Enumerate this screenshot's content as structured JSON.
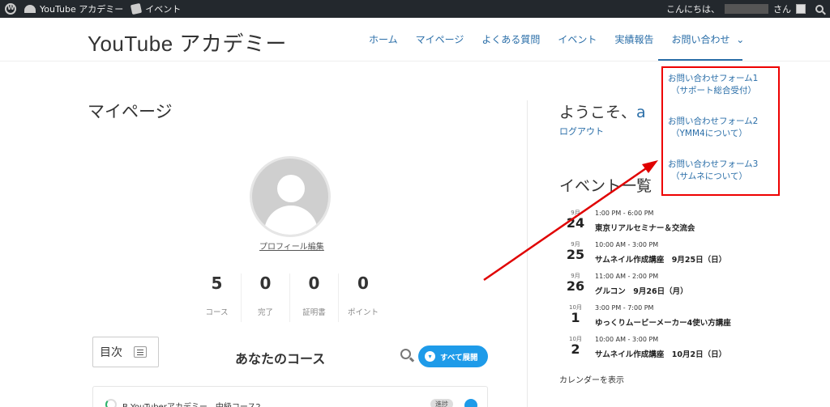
{
  "adminbar": {
    "site": "YouTube アカデミー",
    "event": "イベント",
    "greeting": "こんにちは、",
    "san": "さん"
  },
  "header": {
    "site_title": "YouTube アカデミー",
    "nav": [
      "ホーム",
      "マイページ",
      "よくある質問",
      "イベント",
      "実績報告",
      "お問い合わせ"
    ],
    "nav_chevron": "⌄"
  },
  "dropdown": {
    "items": [
      {
        "line1": "お問い合わせフォーム1",
        "line2": "（サポート総合受付）"
      },
      {
        "line1": "お問い合わせフォーム2",
        "line2": "（YMM4について）"
      },
      {
        "line1": "お問い合わせフォーム3",
        "line2": "（サムネについて）"
      }
    ]
  },
  "main": {
    "page_title": "マイページ",
    "profile_edit": "プロフィール編集",
    "stats": [
      {
        "num": "5",
        "label": "コース"
      },
      {
        "num": "0",
        "label": "完了"
      },
      {
        "num": "0",
        "label": "証明書"
      },
      {
        "num": "0",
        "label": "ポイント"
      }
    ],
    "toc_label": "目次",
    "courses_title": "あなたのコース",
    "expand_all": "すべて展開",
    "course": {
      "title": "B.YouTuberアカデミー　中級コース2",
      "badge": "進捗"
    }
  },
  "sidebar": {
    "welcome": "ようこそ、",
    "welcome_user": "a",
    "logout": "ログアウト",
    "events_title": "イベント一覧",
    "events": [
      {
        "month": "9月",
        "day": "24",
        "time": "1:00 PM - 6:00 PM",
        "name": "東京リアルセミナー＆交流会"
      },
      {
        "month": "9月",
        "day": "25",
        "time": "10:00 AM - 3:00 PM",
        "name": "サムネイル作成講座　9月25日（日）"
      },
      {
        "month": "9月",
        "day": "26",
        "time": "11:00 AM - 2:00 PM",
        "name": "グルコン　9月26日（月）"
      },
      {
        "month": "10月",
        "day": "1",
        "time": "3:00 PM - 7:00 PM",
        "name": "ゆっくりムービーメーカー4使い方講座"
      },
      {
        "month": "10月",
        "day": "2",
        "time": "10:00 AM - 3:00 PM",
        "name": "サムネイル作成講座　10月2日（日）"
      }
    ],
    "show_calendar": "カレンダーを表示"
  },
  "colors": {
    "accent": "#2a6ea8",
    "highlight": "#e00000",
    "button": "#1e9be9",
    "adminbar": "#23282d"
  }
}
